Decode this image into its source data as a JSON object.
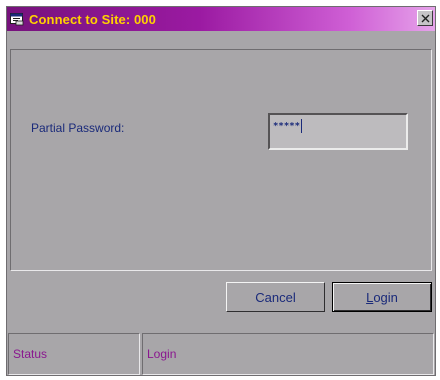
{
  "window": {
    "title": "Connect to Site: 000",
    "title_color": "#ffd200",
    "titlebar_gradient": [
      "#76127c",
      "#9b1aa2",
      "#cf5fd5",
      "#e6a3ea"
    ],
    "background": "#a8a6a9",
    "app_icon": "window-app-icon",
    "close_icon": "close-x-icon"
  },
  "form": {
    "password_label": "Partial Password:",
    "password_value": "*****",
    "label_color": "#1a2a7a"
  },
  "buttons": {
    "cancel_label": "Cancel",
    "login_label": "Login"
  },
  "statusbar": {
    "left_text": "Status",
    "right_text": "Login",
    "text_color": "#8a178f"
  }
}
